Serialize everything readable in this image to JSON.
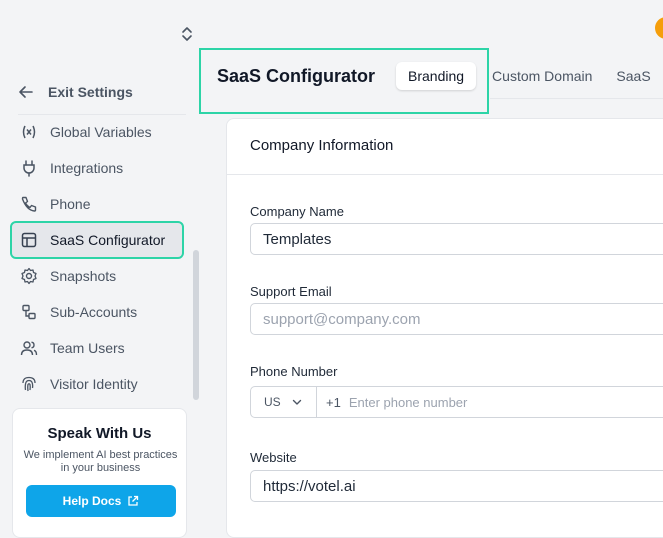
{
  "sidebar": {
    "exit_label": "Exit Settings",
    "items": [
      {
        "label": "Global Variables",
        "icon": "variable-icon"
      },
      {
        "label": "Integrations",
        "icon": "plug-icon"
      },
      {
        "label": "Phone",
        "icon": "phone-icon"
      },
      {
        "label": "SaaS Configurator",
        "icon": "layout-icon",
        "active": true
      },
      {
        "label": "Snapshots",
        "icon": "gear-icon"
      },
      {
        "label": "Sub-Accounts",
        "icon": "sub-accounts-icon"
      },
      {
        "label": "Team Users",
        "icon": "users-icon"
      },
      {
        "label": "Visitor Identity",
        "icon": "fingerprint-icon"
      }
    ],
    "promo": {
      "title": "Speak With Us",
      "subtitle": "We implement AI best practices in your business",
      "button_label": "Help Docs"
    }
  },
  "header": {
    "title": "SaaS Configurator",
    "tabs": [
      "Branding",
      "Custom Domain",
      "SaaS"
    ],
    "active_tab": "Branding"
  },
  "card": {
    "title": "Company Information",
    "company_name": {
      "label": "Company Name",
      "value": "Templates"
    },
    "support_email": {
      "label": "Support Email",
      "placeholder": "support@company.com"
    },
    "phone": {
      "label": "Phone Number",
      "country": "US",
      "dial_code": "+1",
      "placeholder": "Enter phone number"
    },
    "website": {
      "label": "Website",
      "value": "https://votel.ai"
    }
  },
  "colors": {
    "highlight": "#2dd4a7",
    "button": "#0ea5e9",
    "avatar": "#f59e0b"
  }
}
